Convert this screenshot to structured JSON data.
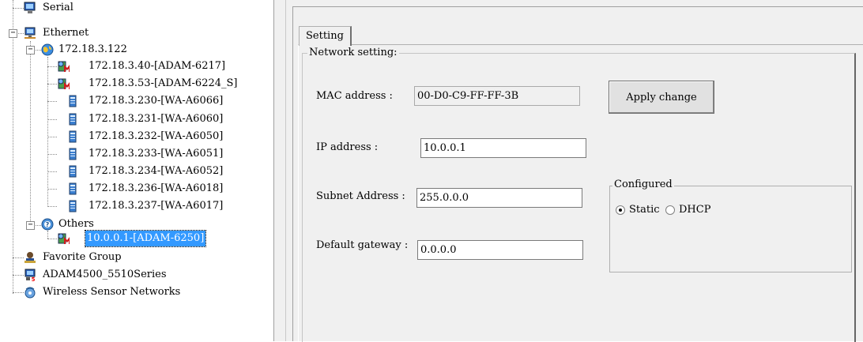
{
  "tree": {
    "serial": "Serial",
    "ethernet": "Ethernet",
    "subnet": "172.18.3.122",
    "devices": [
      "172.18.3.40-[ADAM-6217]",
      "172.18.3.53-[ADAM-6224_S]",
      "172.18.3.230-[WA-A6066]",
      "172.18.3.231-[WA-A6060]",
      "172.18.3.232-[WA-A6050]",
      "172.18.3.233-[WA-A6051]",
      "172.18.3.234-[WA-A6052]",
      "172.18.3.236-[WA-A6018]",
      "172.18.3.237-[WA-A6017]"
    ],
    "others": "Others",
    "selected_device": "10.0.0.1-[ADAM-6250]",
    "favorite": "Favorite Group",
    "adam4500": "ADAM4500_5510Series",
    "wsn": "Wireless Sensor Networks"
  },
  "panel": {
    "tab": "Setting",
    "group": "Network setting:",
    "mac_label": "MAC address :",
    "mac_value": "00-D0-C9-FF-FF-3B",
    "ip_label": "IP address :",
    "ip_value": "10.0.0.1",
    "subnet_label": "Subnet Address :",
    "subnet_value": "255.0.0.0",
    "gateway_label": "Default gateway :",
    "gateway_value": "0.0.0.0",
    "apply_label": "Apply change",
    "configured": {
      "label": "Configured",
      "static": "Static",
      "dhcp": "DHCP",
      "selected": "Static"
    }
  }
}
